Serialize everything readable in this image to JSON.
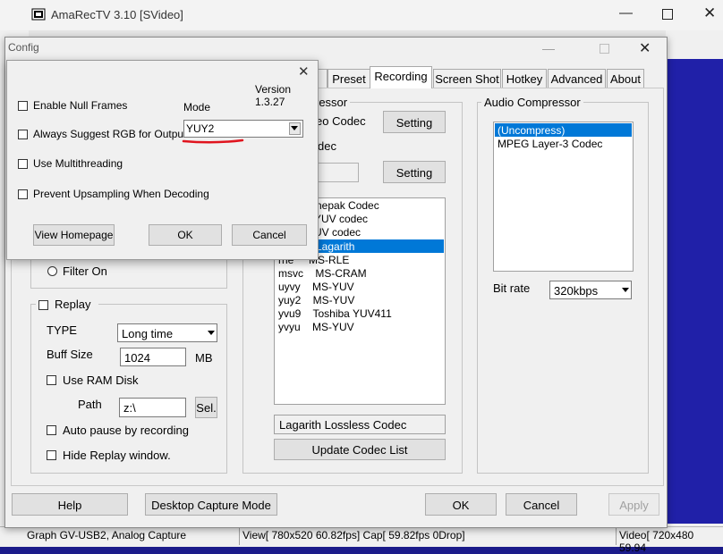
{
  "main": {
    "title": "AmaRecTV 3.10  [SVideo]",
    "status": {
      "device": "Graph GV-USB2, Analog Capture",
      "view": "View[ 780x520 60.82fps]  Cap[ 59.82fps 0Drop]",
      "video": "Video[ 720x480 59.94"
    }
  },
  "config": {
    "title": "Config",
    "tabs": [
      {
        "label": ")"
      },
      {
        "label": "Preset"
      },
      {
        "label": "Recording"
      },
      {
        "label": "Screen Shot"
      },
      {
        "label": "Hotkey"
      },
      {
        "label": "Advanced"
      },
      {
        "label": "About"
      }
    ],
    "compressor": {
      "group_label": "ressor",
      "video_codec_label": "eo Codec",
      "setting_label": "Setting",
      "audio_label": "dec",
      "setting2_label": "Setting",
      "codecs": [
        {
          "text": "nepak Codec"
        },
        {
          "text": "YUV codec"
        },
        {
          "text": "UV codec"
        },
        {
          "text": "Lagarith"
        },
        {
          "text": "rrle     MS-RLE"
        },
        {
          "text": "msvc    MS-CRAM"
        },
        {
          "text": "uyvy    MS-YUV"
        },
        {
          "text": "yuy2    MS-YUV"
        },
        {
          "text": "yvu9    Toshiba YUV411"
        },
        {
          "text": "yvyu    MS-YUV"
        }
      ],
      "selected_codec": "Lagarith Lossless Codec",
      "update_label": "Update Codec List"
    },
    "audio_compressor": {
      "label": "Audio Compressor",
      "items": [
        {
          "text": "(Uncompress)"
        },
        {
          "text": "MPEG Layer-3 Codec"
        }
      ],
      "bitrate_label": "Bit rate",
      "bitrate_value": "320kbps"
    },
    "filter_on_label": "Filter On",
    "replay": {
      "label": "Replay",
      "type_label": "TYPE",
      "type_value": "Long time",
      "buff_label": "Buff Size",
      "buff_value": "1024",
      "buff_unit": "MB",
      "use_ram_label": "Use RAM Disk",
      "path_label": "Path",
      "path_value": "z:\\",
      "sel_label": "Sel.",
      "auto_pause_label": "Auto pause by recording",
      "hide_replay_label": "Hide Replay window."
    },
    "buttons": {
      "help": "Help",
      "desktop": "Desktop Capture Mode",
      "ok": "OK",
      "cancel": "Cancel",
      "apply": "Apply"
    }
  },
  "popup": {
    "version": "Version 1.3.27",
    "enable_null_frames": "Enable Null Frames",
    "always_suggest_rgb": "Always Suggest RGB for Output",
    "use_multithreading": "Use Multithreading",
    "prevent_upsampling": "Prevent Upsampling When Decoding",
    "mode_label": "Mode",
    "mode_value": "YUY2",
    "view_homepage": "View Homepage",
    "ok": "OK",
    "cancel": "Cancel"
  },
  "colors": {
    "selection": "#0078d7",
    "annotation": "#e0141e"
  }
}
